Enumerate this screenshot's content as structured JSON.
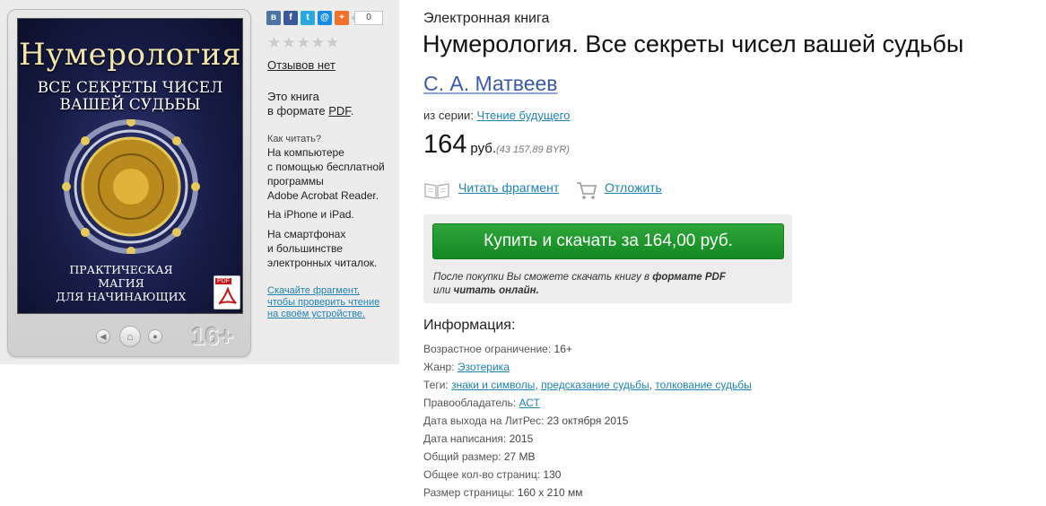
{
  "cover": {
    "title": "Нумерология",
    "subtitle_line1": "Все секреты чисел",
    "subtitle_line2": "вашей судьбы",
    "bottom_line1": "Практическая магия",
    "bottom_line2": "для начинающих",
    "pdf_badge": "PDF",
    "age_badge": "16+"
  },
  "share": {
    "icons": [
      "vk-icon",
      "facebook-icon",
      "twitter-icon",
      "mail-icon",
      "plus-icon"
    ],
    "count": "0"
  },
  "rating": {
    "stars": "★★★★★",
    "reviews_label": "Отзывов нет"
  },
  "format": {
    "line1": "Это книга",
    "line2_prefix": "в формате ",
    "line2_format": "PDF",
    "line2_suffix": "."
  },
  "how_to_read": {
    "title": "Как читать?",
    "block1": [
      "На компьютере",
      "с помощью бесплатной",
      "программы",
      "Adobe Acrobat Reader."
    ],
    "block2": [
      "На iPhone и iPad."
    ],
    "block3": [
      "На смартфонах",
      "и большинстве",
      "электронных читалок."
    ],
    "download_link": [
      "Скачайте фрагмент,",
      "чтобы проверить чтение",
      "на своём устройстве."
    ]
  },
  "book": {
    "type": "Электронная книга",
    "title": "Нумерология. Все секреты чисел вашей судьбы",
    "author": "С. А. Матвеев",
    "series_label": "из серии: ",
    "series_name": "Чтение будущего",
    "price": "164",
    "currency": "руб.",
    "price_byr": "(43 157,89 BYR)"
  },
  "actions": {
    "read_fragment": "Читать фрагмент",
    "postpone": "Отложить"
  },
  "buy": {
    "button_label": "Купить и скачать за 164,00 руб.",
    "note_part1": "После покупки Вы сможете скачать книгу в ",
    "note_bold1": "формате PDF",
    "note_part2": "или ",
    "note_bold2": "читать онлайн."
  },
  "info": {
    "title": "Информация:",
    "age_label": "Возрастное ограничение: ",
    "age_value": "16+",
    "genre_label": "Жанр: ",
    "genre_value": "Эзотерика",
    "tags_label": "Теги: ",
    "tag1": "знаки и символы",
    "tag2": "предсказание судьбы",
    "tag3": "толкование судьбы",
    "sep": ", ",
    "holder_label": "Правообладатель: ",
    "holder_value": "АСТ",
    "release_label": "Дата выхода на ЛитРес: ",
    "release_value": "23 октября 2015",
    "written_label": "Дата написания: ",
    "written_value": "2015",
    "size_label": "Общий размер: ",
    "size_value": "27 MB",
    "pages_label": "Общее кол-во страниц: ",
    "pages_value": "130",
    "pagesize_label": "Размер страницы: ",
    "pagesize_value": "160 x 210 мм"
  },
  "colors": {
    "link": "#1f84b3",
    "buy_green": "#1b9a2c",
    "author": "#3b5aa8"
  }
}
